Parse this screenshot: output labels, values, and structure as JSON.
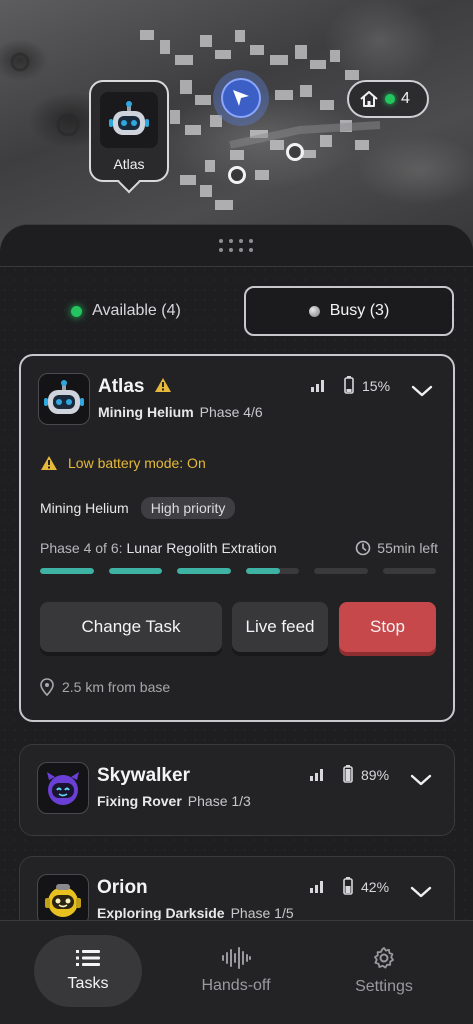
{
  "map": {
    "robot_pin_label": "Atlas",
    "base_count": "4"
  },
  "filters": {
    "available": "Available (4)",
    "busy": "Busy (3)"
  },
  "robots": [
    {
      "name": "Atlas",
      "task": "Mining Helium",
      "phase": "Phase 4/6",
      "battery": "15%",
      "warning": true,
      "low_battery_text": "Low battery mode: On",
      "priority_task": "Mining Helium",
      "priority": "High priority",
      "phase_prefix": "Phase 4 of 6:",
      "phase_name": "Lunar Regolith Extration",
      "time_left": "55min left",
      "progress": [
        1,
        1,
        1,
        0.65,
        0,
        0
      ],
      "actions": {
        "change": "Change Task",
        "live": "Live feed",
        "stop": "Stop"
      },
      "distance": "2.5 km from base",
      "avatar_color": "#2fa8e0"
    },
    {
      "name": "Skywalker",
      "task": "Fixing Rover",
      "phase": "Phase 1/3",
      "battery": "89%",
      "avatar_color": "#6a3fd6"
    },
    {
      "name": "Orion",
      "task": "Exploring Darkside",
      "phase": "Phase 1/5",
      "battery": "42%",
      "avatar_color": "#e8c020"
    }
  ],
  "nav": {
    "tasks": "Tasks",
    "handsoff": "Hands-off",
    "settings": "Settings"
  },
  "colors": {
    "accent_green": "#22c55e",
    "progress_teal": "#3fb3a3",
    "stop_red": "#c7484b",
    "warning_yellow": "#e6b93a"
  }
}
